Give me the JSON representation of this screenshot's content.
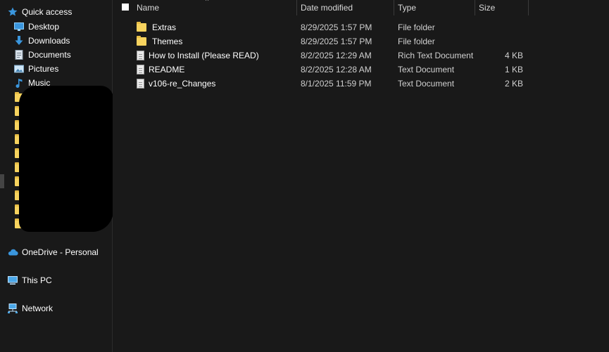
{
  "nav": {
    "quick_access": "Quick access",
    "items": [
      {
        "label": "Desktop",
        "icon": "desktop-icon"
      },
      {
        "label": "Downloads",
        "icon": "download-arrow-icon"
      },
      {
        "label": "Documents",
        "icon": "documents-icon"
      },
      {
        "label": "Pictures",
        "icon": "pictures-icon"
      },
      {
        "label": "Music",
        "icon": "music-note-icon"
      }
    ],
    "onedrive": "OneDrive - Personal",
    "this_pc": "This PC",
    "network": "Network"
  },
  "columns": {
    "name": "Name",
    "date": "Date modified",
    "type": "Type",
    "size": "Size"
  },
  "files": [
    {
      "name": "Extras",
      "date": "8/29/2025 1:57 PM",
      "type": "File folder",
      "size": "",
      "icon": "folder-icon"
    },
    {
      "name": "Themes",
      "date": "8/29/2025 1:57 PM",
      "type": "File folder",
      "size": "",
      "icon": "folder-icon"
    },
    {
      "name": "How to Install (Please READ)",
      "date": "8/2/2025 12:29 AM",
      "type": "Rich Text Document",
      "size": "4 KB",
      "icon": "rtf-document-icon"
    },
    {
      "name": "README",
      "date": "8/2/2025 12:28 AM",
      "type": "Text Document",
      "size": "1 KB",
      "icon": "text-document-icon"
    },
    {
      "name": "v106-re_Changes",
      "date": "8/1/2025 11:59 PM",
      "type": "Text Document",
      "size": "2 KB",
      "icon": "text-document-icon"
    }
  ],
  "colors": {
    "background": "#191919",
    "folder": "#f7d35e",
    "accent_blue": "#3a96dd"
  }
}
